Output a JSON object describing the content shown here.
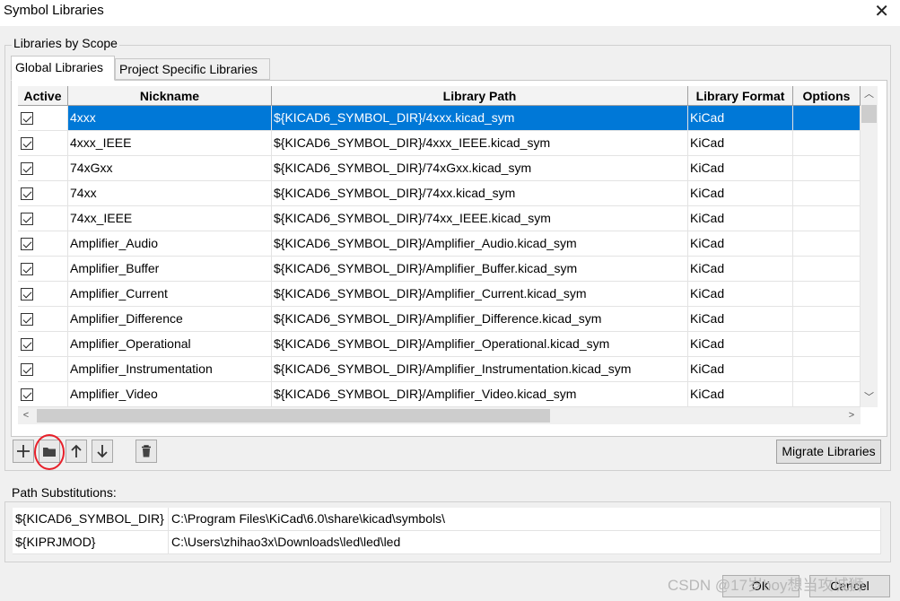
{
  "window": {
    "title": "Symbol Libraries",
    "close_glyph": "✕"
  },
  "group": {
    "title": "Libraries by Scope"
  },
  "tabs": [
    {
      "label": "Global Libraries",
      "active": true
    },
    {
      "label": "Project Specific Libraries",
      "active": false
    }
  ],
  "table": {
    "columns": [
      "Active",
      "Nickname",
      "Library Path",
      "Library Format",
      "Options"
    ],
    "selected_row": 0,
    "rows": [
      {
        "active": true,
        "nickname": "4xxx",
        "path": "${KICAD6_SYMBOL_DIR}/4xxx.kicad_sym",
        "format": "KiCad",
        "options": ""
      },
      {
        "active": true,
        "nickname": "4xxx_IEEE",
        "path": "${KICAD6_SYMBOL_DIR}/4xxx_IEEE.kicad_sym",
        "format": "KiCad",
        "options": ""
      },
      {
        "active": true,
        "nickname": "74xGxx",
        "path": "${KICAD6_SYMBOL_DIR}/74xGxx.kicad_sym",
        "format": "KiCad",
        "options": ""
      },
      {
        "active": true,
        "nickname": "74xx",
        "path": "${KICAD6_SYMBOL_DIR}/74xx.kicad_sym",
        "format": "KiCad",
        "options": ""
      },
      {
        "active": true,
        "nickname": "74xx_IEEE",
        "path": "${KICAD6_SYMBOL_DIR}/74xx_IEEE.kicad_sym",
        "format": "KiCad",
        "options": ""
      },
      {
        "active": true,
        "nickname": "Amplifier_Audio",
        "path": "${KICAD6_SYMBOL_DIR}/Amplifier_Audio.kicad_sym",
        "format": "KiCad",
        "options": ""
      },
      {
        "active": true,
        "nickname": "Amplifier_Buffer",
        "path": "${KICAD6_SYMBOL_DIR}/Amplifier_Buffer.kicad_sym",
        "format": "KiCad",
        "options": ""
      },
      {
        "active": true,
        "nickname": "Amplifier_Current",
        "path": "${KICAD6_SYMBOL_DIR}/Amplifier_Current.kicad_sym",
        "format": "KiCad",
        "options": ""
      },
      {
        "active": true,
        "nickname": "Amplifier_Difference",
        "path": "${KICAD6_SYMBOL_DIR}/Amplifier_Difference.kicad_sym",
        "format": "KiCad",
        "options": ""
      },
      {
        "active": true,
        "nickname": "Amplifier_Operational",
        "path": "${KICAD6_SYMBOL_DIR}/Amplifier_Operational.kicad_sym",
        "format": "KiCad",
        "options": ""
      },
      {
        "active": true,
        "nickname": "Amplifier_Instrumentation",
        "path": "${KICAD6_SYMBOL_DIR}/Amplifier_Instrumentation.kicad_sym",
        "format": "KiCad",
        "options": ""
      },
      {
        "active": true,
        "nickname": "Amplifier_Video",
        "path": "${KICAD6_SYMBOL_DIR}/Amplifier_Video.kicad_sym",
        "format": "KiCad",
        "options": ""
      }
    ]
  },
  "toolbar": {
    "buttons": [
      {
        "name": "add-library-button",
        "icon": "plus-icon"
      },
      {
        "name": "browse-library-button",
        "icon": "folder-icon"
      },
      {
        "name": "move-up-button",
        "icon": "arrow-up-icon"
      },
      {
        "name": "move-down-button",
        "icon": "arrow-down-icon"
      },
      {
        "name": "remove-library-button",
        "icon": "trash-icon"
      }
    ],
    "annotation_color": "#e8202a",
    "migrate_label": "Migrate Libraries"
  },
  "path_substitutions": {
    "label": "Path Substitutions:",
    "rows": [
      {
        "name": "${KICAD6_SYMBOL_DIR}",
        "value": "C:\\Program Files\\KiCad\\6.0\\share\\kicad\\symbols\\"
      },
      {
        "name": "${KIPRJMOD}",
        "value": "C:\\Users\\zhihao3x\\Downloads\\led\\led\\led"
      }
    ]
  },
  "footer": {
    "ok_label": "OK",
    "cancel_label": "Cancel",
    "watermark": "CSDN @17岁boy想当攻城狮"
  },
  "colors": {
    "selection": "#0078d7",
    "dialog_bg": "#f0f0f0"
  }
}
